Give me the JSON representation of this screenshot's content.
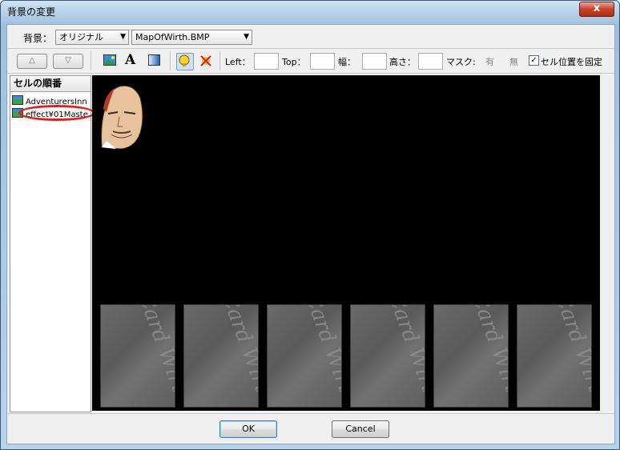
{
  "window": {
    "title": "背景の変更",
    "close_label": "x"
  },
  "header": {
    "background_label": "背景：",
    "type_select": "オリジナル",
    "file_select": "MapOfWirth.BMP"
  },
  "toolbar": {
    "up_label": "△",
    "down_label": "▽",
    "left_label": "Left：",
    "top_label": "Top：",
    "width_label": "幅：",
    "height_label": "高さ：",
    "mask_label": "マスク:",
    "mask_on": "有",
    "mask_off": "無",
    "fix_label": "セル位置を固定",
    "fix_checked": true,
    "icons": [
      "image-icon",
      "text-icon",
      "gradient-icon",
      "pointer-icon",
      "disable-icon"
    ]
  },
  "sidebar": {
    "title": "セルの順番",
    "items": [
      {
        "label": "AdventurersInn"
      },
      {
        "label": "effect¥01Maste"
      }
    ]
  },
  "canvas": {
    "card_text": "Card Wirth",
    "card_count": 6
  },
  "footer": {
    "ok_label": "OK",
    "cancel_label": "Cancel"
  },
  "colors": {
    "highlight": "#e02020",
    "canvas_bg": "#000000"
  }
}
